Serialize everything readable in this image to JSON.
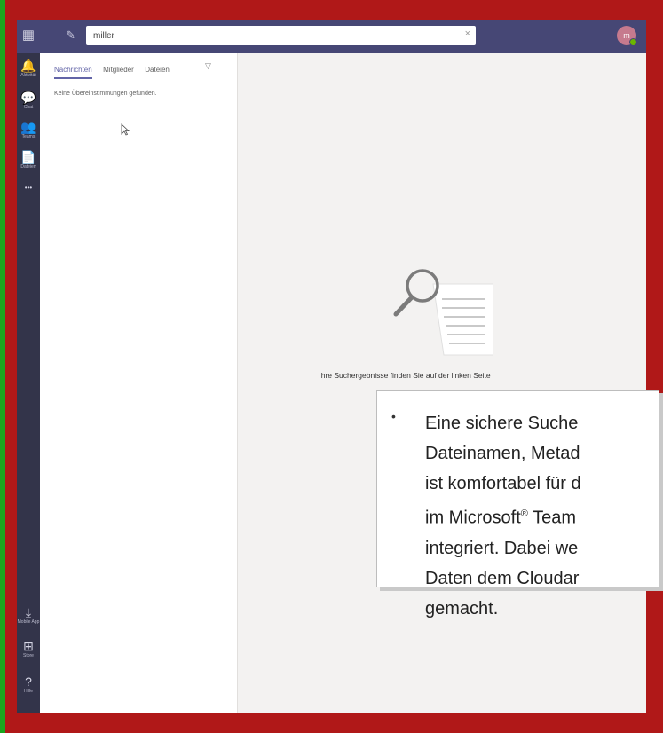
{
  "search": {
    "value": "miller",
    "clear_glyph": "×"
  },
  "user": {
    "avatar_initials": "m"
  },
  "rail": {
    "items": [
      {
        "icon": "bell-icon",
        "glyph": "🔔",
        "label": "Aktivität"
      },
      {
        "icon": "chat-icon",
        "glyph": "💬",
        "label": "Chat"
      },
      {
        "icon": "teams-icon",
        "glyph": "👥",
        "label": "Teams"
      },
      {
        "icon": "files-icon",
        "glyph": "📄",
        "label": "Dateien"
      },
      {
        "icon": "more-icon",
        "glyph": "•••",
        "label": ""
      },
      {
        "icon": "download-icon",
        "glyph": "⤓",
        "label": "Mobile App"
      },
      {
        "icon": "store-icon",
        "glyph": "⊞",
        "label": "Store"
      },
      {
        "icon": "help-icon",
        "glyph": "?",
        "label": "Hilfe"
      }
    ]
  },
  "search_panel": {
    "tabs": [
      "Nachrichten",
      "Mitglieder",
      "Dateien"
    ],
    "no_results": "Keine Übereinstimmungen gefunden."
  },
  "main": {
    "empty_state": "Ihre Suchergebnisse finden Sie auf der linken Seite"
  },
  "callout": {
    "bullet": "•",
    "line1": "Eine sichere Suche\nDateinamen, Metad\nist komfortabel für d\nim Microsoft",
    "trademark": "®",
    "line2": " Team\nintegriert. Dabei we\nDaten dem Cloudar\ngemacht."
  },
  "colors": {
    "titlebar": "#464775",
    "rail": "#33344a",
    "accent": "#6264a7",
    "frame_red": "#b01818",
    "frame_green": "#1aa51e"
  }
}
